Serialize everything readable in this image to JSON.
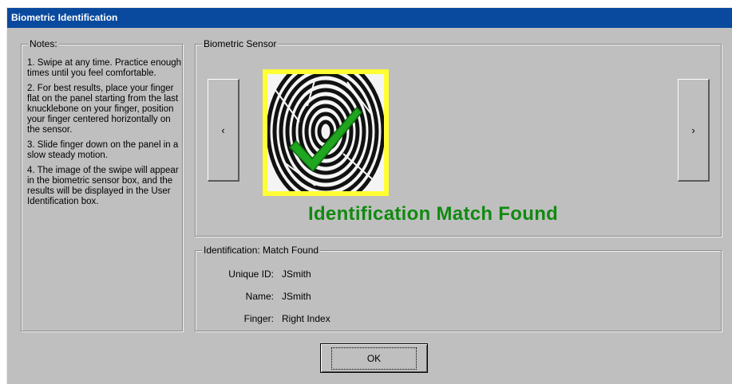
{
  "window": {
    "title": "Biometric Identification"
  },
  "notes": {
    "legend": "Notes:",
    "items": [
      "1. Swipe at any time. Practice enough times until you feel comfortable.",
      "2. For best results, place your finger flat on the panel starting from the last knucklebone on your finger, position your finger centered horizontally on the sensor.",
      "3. Slide finger down on the panel in a slow steady motion.",
      "4. The image of the swipe will appear in the biometric sensor box, and the results will be displayed in the User Identification box."
    ]
  },
  "sensor": {
    "legend": "Biometric Sensor",
    "prev_label": "‹",
    "next_label": "›",
    "status": "Identification Match Found",
    "status_color": "#108a10",
    "frame_color": "#ffff33"
  },
  "identification": {
    "legend": "Identification: Match Found",
    "unique_id_label": "Unique ID:",
    "unique_id": "JSmith",
    "name_label": "Name:",
    "name": "JSmith",
    "finger_label": "Finger:",
    "finger": "Right Index"
  },
  "footer": {
    "ok_label": "OK"
  }
}
